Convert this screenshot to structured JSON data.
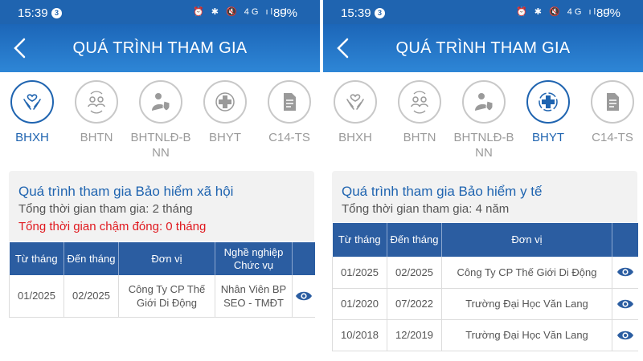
{
  "status": {
    "time": "15:39",
    "badge": "3",
    "icons": "⏰ ✱ 🔇 4G ıl ıl",
    "battery": "89%"
  },
  "appbar": {
    "title": "QUÁ TRÌNH THAM GIA"
  },
  "tabs": [
    {
      "label": "BHXH",
      "icon": "hands-heart-icon"
    },
    {
      "label": "BHTN",
      "icon": "people-exchange-icon"
    },
    {
      "label": "BHTNLĐ-B\nNN",
      "icon": "worker-shield-icon"
    },
    {
      "label": "BHYT",
      "icon": "medical-cross-icon"
    },
    {
      "label": "C14-TS",
      "icon": "document-icon"
    }
  ],
  "left": {
    "active_tab": "BHXH",
    "card": {
      "title": "Quá trình tham gia Bảo hiểm xã hội",
      "duration": "Tổng thời gian tham gia: 2 tháng",
      "late": "Tổng thời gian chậm đóng: 0 tháng"
    },
    "headers": [
      "Từ tháng",
      "Đến tháng",
      "Đơn vị",
      "Nghề nghiệp Chức vụ"
    ],
    "rows": [
      {
        "from": "01/2025",
        "to": "02/2025",
        "unit": "Công Ty CP Thế Giới Di Động",
        "job": "Nhân Viên BP SEO - TMĐT"
      }
    ]
  },
  "right": {
    "active_tab": "BHYT",
    "card": {
      "title": "Quá trình tham gia Bảo hiểm y tế",
      "duration": "Tổng thời gian tham gia: 4 năm"
    },
    "headers": [
      "Từ tháng",
      "Đến tháng",
      "Đơn vị"
    ],
    "rows": [
      {
        "from": "01/2025",
        "to": "02/2025",
        "unit": "Công Ty CP Thế Giới Di Động"
      },
      {
        "from": "01/2020",
        "to": "07/2022",
        "unit": "Trường Đại Học Văn Lang"
      },
      {
        "from": "10/2018",
        "to": "12/2019",
        "unit": "Trường Đại Học Văn Lang"
      }
    ]
  },
  "colors": {
    "primary": "#1f64b0",
    "header": "#2b5da1",
    "danger": "#e0191f",
    "inactive": "#9a9a9a"
  }
}
